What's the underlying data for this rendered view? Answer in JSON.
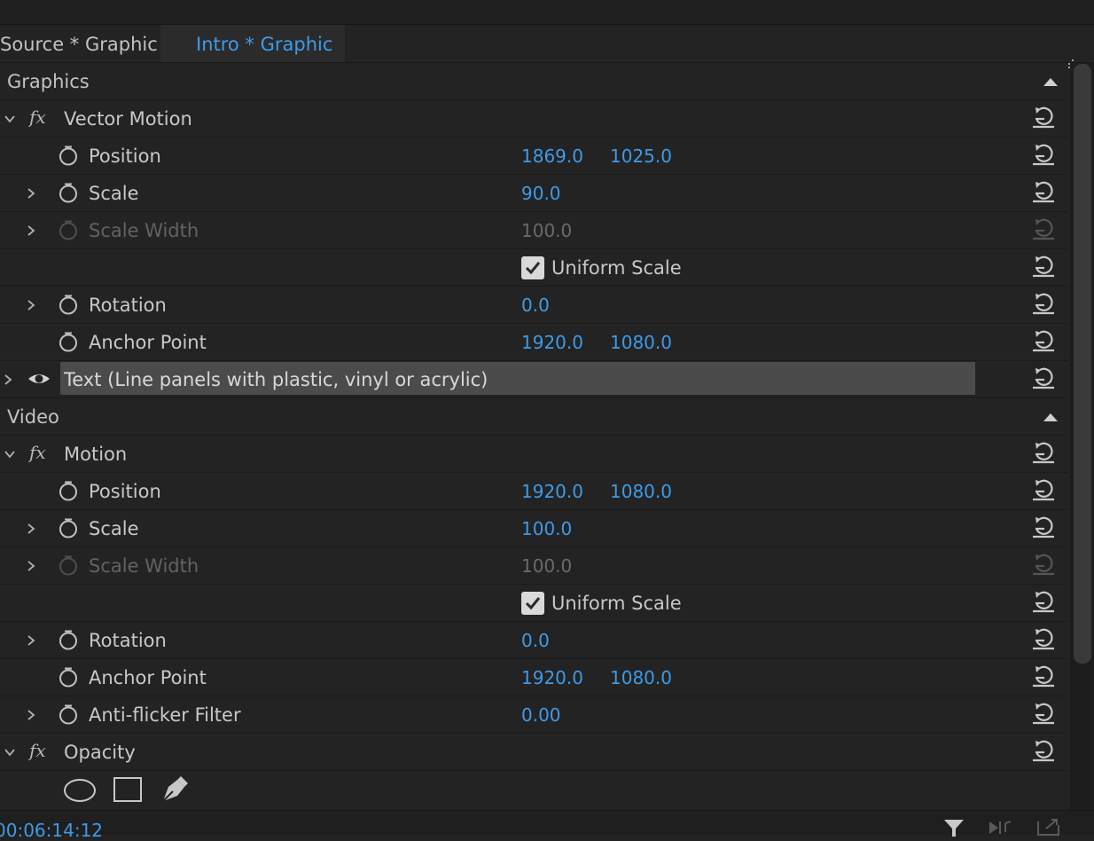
{
  "tabs": {
    "source_label": "Source * Graphic",
    "intro_label": "Intro * Graphic"
  },
  "graphics": {
    "header": "Graphics",
    "vector_motion": {
      "title": "Vector Motion",
      "position_label": "Position",
      "position_x": "1869.0",
      "position_y": "1025.0",
      "scale_label": "Scale",
      "scale_value": "90.0",
      "scale_width_label": "Scale Width",
      "scale_width_value": "100.0",
      "uniform_scale_label": "Uniform Scale",
      "uniform_scale_checked": true,
      "rotation_label": "Rotation",
      "rotation_value": "0.0",
      "anchor_label": "Anchor Point",
      "anchor_x": "1920.0",
      "anchor_y": "1080.0"
    },
    "text_layer_label": "Text (Line panels with plastic, vinyl or acrylic)"
  },
  "video": {
    "header": "Video",
    "motion": {
      "title": "Motion",
      "position_label": "Position",
      "position_x": "1920.0",
      "position_y": "1080.0",
      "scale_label": "Scale",
      "scale_value": "100.0",
      "scale_width_label": "Scale Width",
      "scale_width_value": "100.0",
      "uniform_scale_label": "Uniform Scale",
      "uniform_scale_checked": true,
      "rotation_label": "Rotation",
      "rotation_value": "0.0",
      "anchor_label": "Anchor Point",
      "anchor_x": "1920.0",
      "anchor_y": "1080.0",
      "antiflicker_label": "Anti-flicker Filter",
      "antiflicker_value": "0.00"
    },
    "opacity": {
      "title": "Opacity"
    }
  },
  "footer": {
    "timecode": "00:06:14:12"
  },
  "icons": {
    "tools": [
      "ellipse-mask-icon",
      "rectangle-mask-icon",
      "pen-mask-icon"
    ],
    "footer": [
      "filter-icon",
      "play-audio-icon",
      "export-icon"
    ]
  },
  "colors": {
    "accent": "#3f9ae8",
    "background": "#232323",
    "text": "#c8c8c8",
    "disabled": "#626262",
    "selected_row": "#4b4b4b"
  }
}
